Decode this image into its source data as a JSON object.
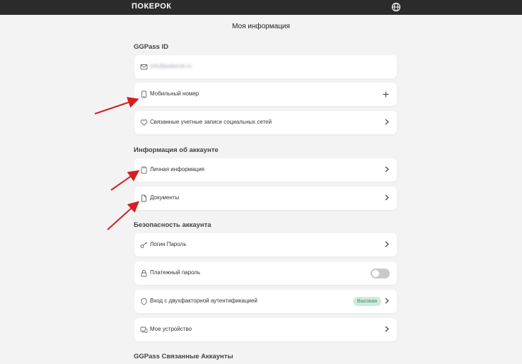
{
  "header": {
    "logo": "ПОКЕРОК",
    "language_icon": "globe-icon"
  },
  "page": {
    "title": "Моя информация"
  },
  "sections": {
    "ggpass": {
      "title": "GGPass ID",
      "email_value": "info@pokerok.ru",
      "mobile_label": "Мобильный номер",
      "social_label": "Связанные учетные записи социальных сетей"
    },
    "account": {
      "title": "Информация об аккаунте",
      "personal_label": "Личная информация",
      "documents_label": "Документы"
    },
    "security": {
      "title": "Безопасность аккаунта",
      "login_label": "Логин Пароль",
      "payment_label": "Платежный пароль",
      "payment_toggle": "off",
      "twofa_label": "Вход с двухфакторной аутентификацией",
      "twofa_badge": "Высокая",
      "device_label": "Мое устройство"
    },
    "linked": {
      "title": "GGPass Связанные Аккаунты"
    }
  },
  "colors": {
    "topbar": "#2b2b2b",
    "background": "#f3f3f3",
    "card": "#ffffff",
    "badge_bg": "#cfeadf",
    "badge_text": "#2f8a62",
    "annotation_arrow": "#d42020"
  }
}
